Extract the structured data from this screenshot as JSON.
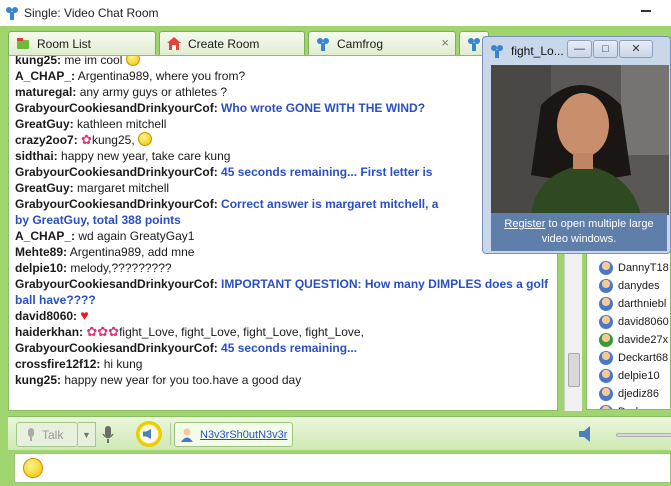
{
  "window": {
    "title": "Single: Video Chat Room"
  },
  "tabs": [
    {
      "label": "Room List"
    },
    {
      "label": "Create Room"
    },
    {
      "label": "Camfrog",
      "close": "×"
    }
  ],
  "messages": [
    {
      "user": "kung25:",
      "text": "me im cool",
      "emoji": true
    },
    {
      "user": "A_CHAP_:",
      "text": "Argentina989, where you from?"
    },
    {
      "user": "maturegal:",
      "text": "any army guys or athletes ?"
    },
    {
      "user": "GrabyourCookiesandDrinkyourCof:",
      "text": "Who wrote GONE WITH THE WIND?",
      "bold": true
    },
    {
      "user": "GreatGuy:",
      "text": "kathleen mitchell"
    },
    {
      "user": "crazy2oo7:",
      "text": "kung25,",
      "flower": true,
      "emoji": true
    },
    {
      "user": "sidthai:",
      "text": "happy new year, take care kung"
    },
    {
      "user": "GrabyourCookiesandDrinkyourCof:",
      "text": "45 seconds remaining... First letter is",
      "bold": true
    },
    {
      "user": "GreatGuy:",
      "text": "margaret mitchell"
    },
    {
      "user": "GrabyourCookiesandDrinkyourCof:",
      "text": "Correct answer is margaret mitchell, a",
      "bold": true
    },
    {
      "user": "",
      "text": "by GreatGuy, total 388 points",
      "bold": true
    },
    {
      "user": "A_CHAP_:",
      "text": "wd again GreatyGay1"
    },
    {
      "user": "Mehte89:",
      "text": "Argentina989, add mne"
    },
    {
      "user": "delpie10:",
      "text": "melody,?????????"
    },
    {
      "user": "GrabyourCookiesandDrinkyourCof:",
      "text": "IMPORTANT QUESTION: How many DIMPLES does a golf ball have????",
      "bold": true,
      "wrap": true
    },
    {
      "user": "david8060:",
      "text": "",
      "heart": true
    },
    {
      "user": "haiderkhan:",
      "text": "fight_Love, fight_Love, fight_Love, fight_Love,",
      "flowers3": true
    },
    {
      "user": "GrabyourCookiesandDrinkyourCof:",
      "text": "45 seconds remaining...",
      "bold": true
    },
    {
      "user": "crossfire12f12:",
      "text": "hi kung"
    },
    {
      "user": "kung25:",
      "text": "happy new year for you too.have a good day"
    }
  ],
  "users": [
    {
      "name": "DannyT18"
    },
    {
      "name": "danydes"
    },
    {
      "name": "darthniebl"
    },
    {
      "name": "david8060"
    },
    {
      "name": "davide27x",
      "green": true
    },
    {
      "name": "Deckart68"
    },
    {
      "name": "delpie10"
    },
    {
      "name": "djediz86"
    },
    {
      "name": "Dod..."
    }
  ],
  "video": {
    "title": "fight_Lo...",
    "caption_link": "Register",
    "caption_text": " to open multiple large video windows."
  },
  "talkbar": {
    "talk_label": "Talk",
    "talker": "N3v3rSh0utN3v3r"
  },
  "input": {
    "placeholder": ""
  }
}
